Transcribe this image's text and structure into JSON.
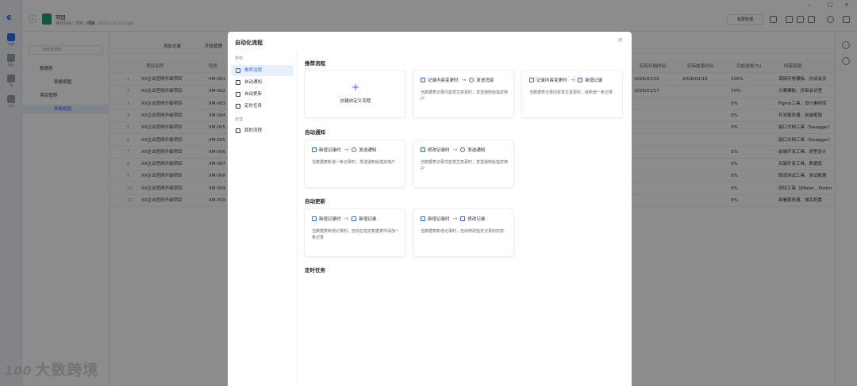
{
  "rail": {
    "items": [
      {
        "label": "文档",
        "icon": "document-icon",
        "active": true
      },
      {
        "label": "模板",
        "icon": "template-icon"
      },
      {
        "label": "我",
        "icon": "user-icon"
      },
      {
        "label": "空间",
        "icon": "space-icon"
      }
    ]
  },
  "header": {
    "title": "项目",
    "path_prefix": "我的空间 / 项目 / ",
    "path_current": "项目",
    "time": "2026/01/18 09:45 编辑",
    "perm_button": "权限管理"
  },
  "sidebar": {
    "search_placeholder": "搜索数据表",
    "tree": [
      {
        "label": "数据表",
        "level": 0
      },
      {
        "label": "表格视图",
        "level": 1
      },
      {
        "label": "项目管理",
        "level": 0
      },
      {
        "label": "表格视图",
        "level": 1,
        "active": true
      }
    ]
  },
  "grid": {
    "toolbar": {
      "add_record": "添加记录",
      "field_manage": "字段管理"
    },
    "columns": [
      "项目名称",
      "任务",
      "实际开始时间",
      "实际结束时间",
      "完成进度(%)",
      "所需资源"
    ],
    "rows": [
      {
        "n": "1",
        "name": "XX企业官网升级项目",
        "task": "XM-001",
        "start": "2026/01/10",
        "end": "2026/01/15",
        "prog": "100%",
        "res": "调研问卷模板、访谈会议"
      },
      {
        "n": "2",
        "name": "XX企业官网升级项目",
        "task": "XM-002",
        "start": "2026/01/17",
        "end": "",
        "prog": "70%",
        "res": "方案模板、评审会议室"
      },
      {
        "n": "3",
        "name": "XX企业官网升级项目",
        "task": "XM-003",
        "start": "",
        "end": "",
        "prog": "0%",
        "res": "Figma工具、设计素材库"
      },
      {
        "n": "4",
        "name": "XX企业官网升级项目",
        "task": "XM-004",
        "start": "",
        "end": "",
        "prog": "0%",
        "res": "开发服务器、前端框架"
      },
      {
        "n": "5",
        "name": "XX企业官网升级项目",
        "task": "XM-005",
        "start": "",
        "end": "",
        "prog": "0%",
        "res": "接口文档工具（Swagger）"
      },
      {
        "n": "6",
        "name": "XX企业官网升级项目",
        "task": "XM-005",
        "start": "",
        "end": "",
        "prog": "",
        "res": "接口文档工具（Swagger）"
      },
      {
        "n": "7",
        "name": "XX企业官网升级项目",
        "task": "XM-006",
        "start": "",
        "end": "",
        "prog": "0%",
        "res": "前端开发工具、原型设计"
      },
      {
        "n": "8",
        "name": "XX企业官网升级项目",
        "task": "XM-007",
        "start": "",
        "end": "",
        "prog": "0%",
        "res": "后端开发工具、数据库"
      },
      {
        "n": "9",
        "name": "XX企业官网升级项目",
        "task": "XM-008",
        "start": "",
        "end": "",
        "prog": "0%",
        "res": "联调测试工具、测试数据"
      },
      {
        "n": "10",
        "name": "XX企业官网升级项目",
        "task": "XM-009",
        "start": "",
        "end": "",
        "prog": "0%",
        "res": "测试工具（JMeter、Postman）"
      },
      {
        "n": "11",
        "name": "XX企业官网升级项目",
        "task": "XM-010",
        "start": "",
        "end": "",
        "prog": "0%",
        "res": "部署服务器、域名配置"
      }
    ]
  },
  "watermark": {
    "logo": "100",
    "text": "大数跨境"
  },
  "modal": {
    "title": "自动化流程",
    "close": "×",
    "nav_groups": [
      {
        "label": "推荐",
        "items": [
          {
            "label": "推荐流程",
            "icon": "flow-icon",
            "active": true
          },
          {
            "label": "自动通知",
            "icon": "bell-icon"
          },
          {
            "label": "自动更新",
            "icon": "refresh-icon"
          },
          {
            "label": "定时任务",
            "icon": "clock-icon"
          }
        ]
      },
      {
        "label": "管理",
        "items": [
          {
            "label": "我的流程",
            "icon": "my-flow-icon"
          }
        ]
      }
    ],
    "sections": [
      {
        "title": "推荐流程",
        "cards": [
          {
            "create": true,
            "label": "创建自定义流程"
          },
          {
            "trigger": "记录内容变更时",
            "action": "发送消息",
            "desc": "当数据表记录内容发生变更时，发送通知给指定用户"
          },
          {
            "trigger": "记录内容变更时",
            "action": "新增记录",
            "desc": "当数据表记录内容发生变更时，就新增一条记录"
          }
        ]
      },
      {
        "title": "自动通知",
        "cards": [
          {
            "trigger": "新增记录时",
            "action": "发送通知",
            "desc": "当数据表新增一条记录时，发送通知给指定用户"
          },
          {
            "trigger": "修改记录时",
            "action": "发送通知",
            "desc": "当数据表记录内容发生变更时，发送通知给指定用户"
          }
        ]
      },
      {
        "title": "自动更新",
        "cards": [
          {
            "trigger": "新增记录时",
            "action": "新增记录",
            "desc": "当数据表新增记录时，自动在指定数据表中添加一条记录"
          },
          {
            "trigger": "新增记录时",
            "action": "修改记录",
            "desc": "当数据表新增记录时，自动修改指定记录的内容"
          }
        ]
      },
      {
        "title": "定时任务",
        "cards": []
      }
    ]
  }
}
